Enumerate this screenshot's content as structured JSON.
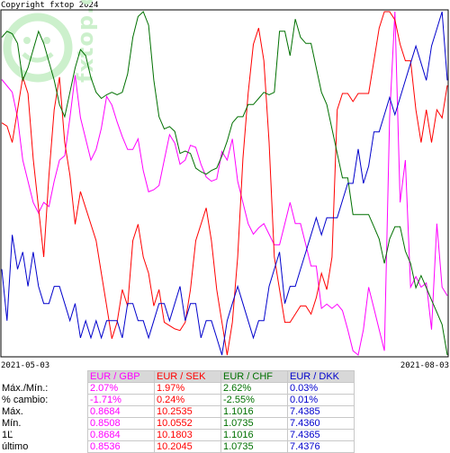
{
  "copyright": "Copyright fxtop 2024",
  "watermark": {
    "text": "fxtop.com",
    "color": "#ccf0cc"
  },
  "chart_data": {
    "type": "line",
    "x_range": [
      "2021-05-03",
      "2021-08-03"
    ],
    "x_labels": [
      "2021-05-03",
      "2021-08-03"
    ],
    "grid": false,
    "series": [
      {
        "name": "EUR / GBP",
        "color": "#ff00ff",
        "values": [
          0.8638,
          0.8635,
          0.8632,
          0.862,
          0.86,
          0.859,
          0.858,
          0.8575,
          0.858,
          0.8578,
          0.859,
          0.86,
          0.8602,
          0.862,
          0.864,
          0.862,
          0.861,
          0.86,
          0.8605,
          0.8615,
          0.863,
          0.8626,
          0.8618,
          0.8611,
          0.8605,
          0.8605,
          0.861,
          0.8595,
          0.8585,
          0.8586,
          0.8588,
          0.86,
          0.8612,
          0.8608,
          0.8598,
          0.86,
          0.8607,
          0.8606,
          0.8598,
          0.8592,
          0.859,
          0.8591,
          0.8604,
          0.86,
          0.861,
          0.859,
          0.858,
          0.857,
          0.8565,
          0.8568,
          0.857,
          0.8565,
          0.856,
          0.856,
          0.857,
          0.858,
          0.857,
          0.857,
          0.856,
          0.855,
          0.855,
          0.853,
          0.8532,
          0.853,
          0.8532,
          0.8529,
          0.852,
          0.851,
          0.8508,
          0.852,
          0.854,
          0.853,
          0.852,
          0.851,
          0.862,
          0.867,
          0.858,
          0.86,
          0.854,
          0.8545,
          0.854,
          0.8542,
          0.852,
          0.857,
          0.854,
          0.8536
        ]
      },
      {
        "name": "EUR / SEK",
        "color": "#ff0000",
        "values": [
          10.182,
          10.18,
          10.17,
          10.19,
          10.21,
          10.2,
          10.16,
          10.13,
          10.1,
          10.15,
          10.19,
          10.21,
          10.17,
          10.15,
          10.12,
          10.14,
          10.13,
          10.12,
          10.11,
          10.09,
          10.07,
          10.05,
          10.06,
          10.08,
          10.07,
          10.11,
          10.12,
          10.1,
          10.09,
          10.07,
          10.08,
          10.06,
          10.058,
          10.056,
          10.055,
          10.06,
          10.08,
          10.11,
          10.12,
          10.13,
          10.11,
          10.08,
          10.06,
          10.04,
          10.06,
          10.1,
          10.16,
          10.2,
          10.23,
          10.24,
          10.22,
          10.17,
          10.1,
          10.08,
          10.06,
          10.06,
          10.065,
          10.07,
          10.07,
          10.065,
          10.075,
          10.09,
          10.08,
          10.1,
          10.19,
          10.2,
          10.2,
          10.195,
          10.2,
          10.2,
          10.2,
          10.22,
          10.24,
          10.25,
          10.25,
          10.245,
          10.23,
          10.22,
          10.22,
          10.19,
          10.17,
          10.19,
          10.17,
          10.19,
          10.185,
          10.205
        ]
      },
      {
        "name": "EUR / CHF",
        "color": "#007000",
        "values": [
          1.0995,
          1.1,
          1.0998,
          1.099,
          1.096,
          1.097,
          1.0985,
          1.1,
          1.099,
          1.0975,
          1.096,
          1.094,
          1.093,
          1.095,
          1.097,
          1.0985,
          1.098,
          1.0962,
          1.095,
          1.0945,
          1.0948,
          1.095,
          1.0948,
          1.095,
          1.0965,
          1.0995,
          1.1012,
          1.1016,
          1.1005,
          1.096,
          1.093,
          1.092,
          1.0922,
          1.0918,
          1.09,
          1.0902,
          1.09,
          1.0888,
          1.0885,
          1.0883,
          1.0886,
          1.0888,
          1.0898,
          1.091,
          1.0925,
          1.093,
          1.093,
          1.094,
          1.094,
          1.0945,
          1.095,
          1.0948,
          1.095,
          1.1,
          1.1,
          1.098,
          1.101,
          1.0995,
          1.099,
          1.099,
          1.097,
          1.095,
          1.094,
          1.092,
          1.09,
          1.088,
          1.088,
          1.085,
          1.085,
          1.085,
          1.085,
          1.084,
          1.083,
          1.081,
          1.083,
          1.084,
          1.084,
          1.082,
          1.081,
          1.079,
          1.08,
          1.079,
          1.078,
          1.077,
          1.076,
          1.0735
        ]
      },
      {
        "name": "EUR / DKK",
        "color": "#0000cc",
        "values": [
          7.4365,
          7.4362,
          7.4367,
          7.4365,
          7.4366,
          7.4364,
          7.4366,
          7.4364,
          7.4363,
          7.4363,
          7.4364,
          7.4364,
          7.4363,
          7.4362,
          7.4363,
          7.4361,
          7.4362,
          7.4361,
          7.4362,
          7.4361,
          7.4362,
          7.4362,
          7.4362,
          7.4361,
          7.4363,
          7.4363,
          7.4362,
          7.4362,
          7.4361,
          7.4362,
          7.4363,
          7.4363,
          7.4362,
          7.4363,
          7.4364,
          7.4362,
          7.4363,
          7.4363,
          7.4361,
          7.4362,
          7.4362,
          7.4361,
          7.436,
          7.4362,
          7.4363,
          7.4364,
          7.4363,
          7.4362,
          7.4361,
          7.4362,
          7.4362,
          7.4364,
          7.4365,
          7.4366,
          7.4363,
          7.4364,
          7.4364,
          7.4365,
          7.4366,
          7.4367,
          7.4368,
          7.4367,
          7.4368,
          7.4368,
          7.4368,
          7.4369,
          7.437,
          7.437,
          7.4372,
          7.437,
          7.4371,
          7.4373,
          7.4373,
          7.4374,
          7.4375,
          7.4374,
          7.4375,
          7.4376,
          7.4377,
          7.4378,
          7.4377,
          7.4376,
          7.4378,
          7.4379,
          7.438,
          7.4376
        ]
      }
    ]
  },
  "stats": {
    "headers": [
      "EUR / GBP",
      "EUR / SEK",
      "EUR / CHF",
      "EUR / DKK"
    ],
    "header_colors": [
      "#ff00ff",
      "#ff0000",
      "#007000",
      "#0000cc"
    ],
    "rows": [
      {
        "label": "Máx./Mín.:",
        "values": [
          "2.07%",
          "1.97%",
          "2.62%",
          "0.03%"
        ]
      },
      {
        "label": "% cambio:",
        "values": [
          "-1.71%",
          "0.24%",
          "-2.55%",
          "0.01%"
        ]
      },
      {
        "label": "Máx.",
        "values": [
          "0.8684",
          "10.2535",
          "1.1016",
          "7.4385"
        ]
      },
      {
        "label": "Mín.",
        "values": [
          "0.8508",
          "10.0552",
          "1.0735",
          "7.4360"
        ]
      },
      {
        "label": "1Ľ",
        "values": [
          "0.8684",
          "10.1803",
          "1.1016",
          "7.4365"
        ]
      },
      {
        "label": "último",
        "values": [
          "0.8536",
          "10.2045",
          "1.0735",
          "7.4376"
        ]
      }
    ]
  }
}
